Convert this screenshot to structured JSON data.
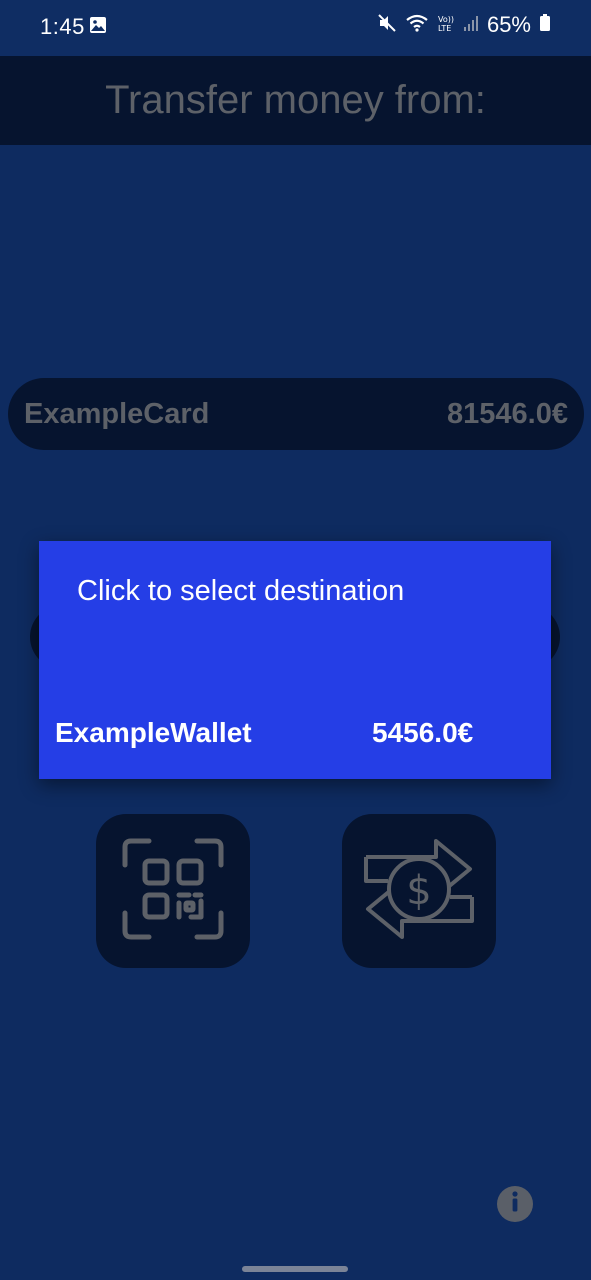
{
  "status_bar": {
    "time": "1:45",
    "battery": "65%",
    "icons": [
      "image-notification-icon",
      "mute-icon",
      "wifi-icon",
      "volte-lte-icon",
      "signal-icon",
      "battery-icon"
    ]
  },
  "header": {
    "title": "Transfer money from:"
  },
  "source_card": {
    "name": "ExampleCard",
    "balance": "81546.0€"
  },
  "dialog": {
    "title": "Click to select destination",
    "items": [
      {
        "name": "ExampleWallet",
        "balance": "5456.0€"
      }
    ]
  },
  "actions": {
    "qr_icon": "qr-scan-icon",
    "transfer_icon": "money-transfer-icon",
    "info_icon": "info-icon"
  },
  "colors": {
    "background": "#0e2b60",
    "header_background": "#06142f",
    "dialog_background": "#253ee6",
    "muted_text": "#5d6168"
  }
}
